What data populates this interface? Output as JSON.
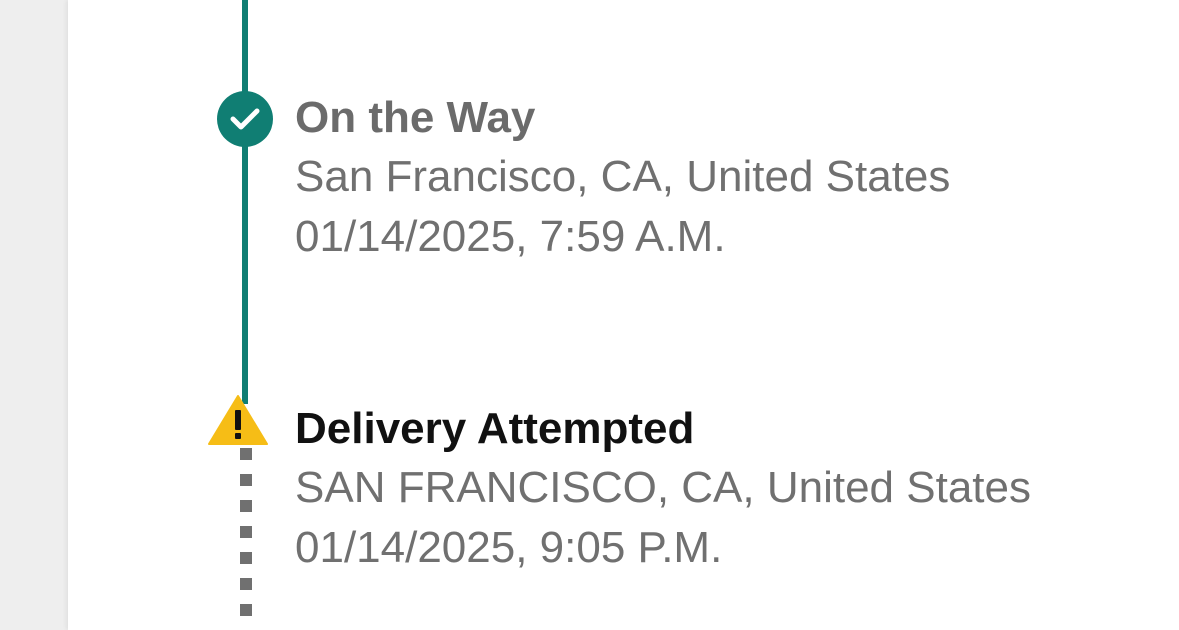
{
  "colors": {
    "timeline_teal": "#107e73",
    "warning_yellow": "#f6bd16",
    "muted_text": "#707070",
    "active_text": "#111111",
    "background": "#eeeeee"
  },
  "events": [
    {
      "icon": "check-circle-icon",
      "status": "On the Way",
      "location": "San Francisco, CA, United States",
      "timestamp": "01/14/2025, 7:59 A.M."
    },
    {
      "icon": "warning-triangle-icon",
      "status": "Delivery Attempted",
      "location": "SAN FRANCISCO, CA, United States",
      "timestamp": "01/14/2025, 9:05 P.M."
    }
  ]
}
